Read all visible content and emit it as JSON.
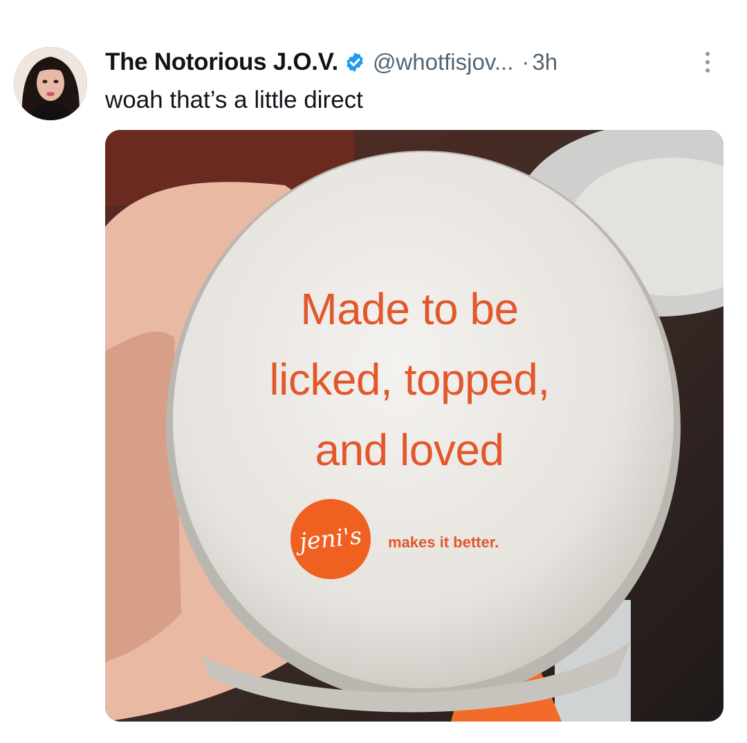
{
  "tweet": {
    "display_name": "The Notorious J.O.V.",
    "verified_icon": "verified-badge-icon",
    "handle": "@whotfisjov...",
    "separator": "·",
    "time": "3h",
    "more_icon": "more-options-icon",
    "text": "woah that’s a little direct"
  },
  "media": {
    "lid_line_1": "Made to be",
    "lid_line_2": "licked, topped,",
    "lid_line_3": "and loved",
    "logo_text": "jeni's",
    "tagline": "makes it better."
  },
  "colors": {
    "accent_orange": "#e2572b",
    "logo_orange": "#ef6021",
    "verified_blue": "#1d9bf0",
    "secondary_text": "#536471"
  }
}
